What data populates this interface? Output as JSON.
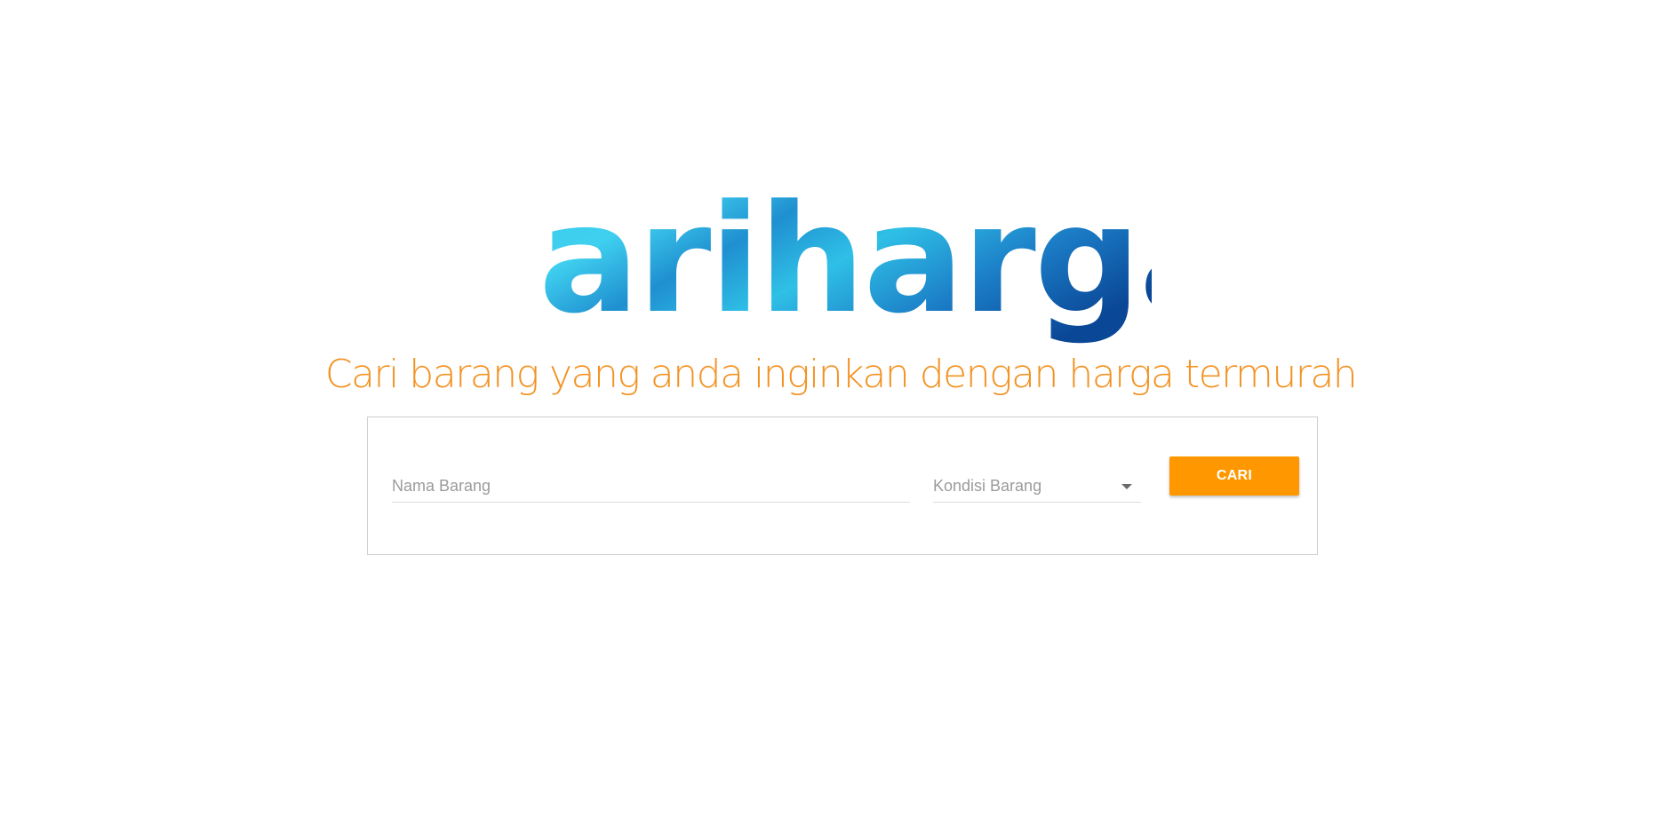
{
  "logo": {
    "text": "cariharga",
    "colors": [
      "#37c6e6",
      "#1a8fd4",
      "#0b4f9c"
    ]
  },
  "tagline": "Cari barang yang anda inginkan dengan harga termurah",
  "search": {
    "name_placeholder": "Nama Barang",
    "condition_value": "Kondisi Barang",
    "button_label": "CARI"
  },
  "colors": {
    "accent": "#ff9800",
    "tagline": "#f29324",
    "border": "#cfcfcf"
  }
}
